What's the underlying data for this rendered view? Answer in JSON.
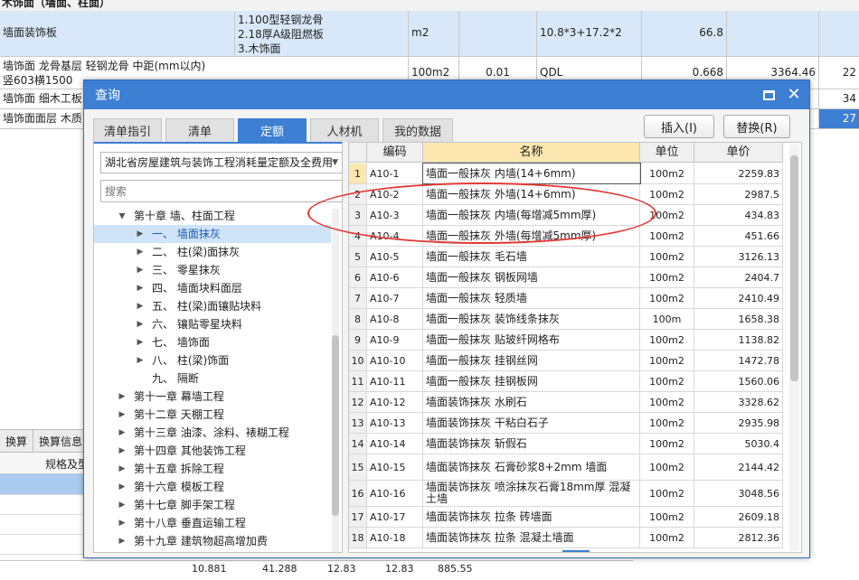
{
  "background": {
    "title": "木饰面（墙面、柱面）",
    "rows": [
      {
        "c1": "墙面装饰板",
        "c2": "1.100型轻钢龙骨\n2.18厚A级阻燃板\n3.木饰面",
        "c3": "m2",
        "c4": "",
        "c5": "10.8*3+17.2*2",
        "c6": "66.8",
        "c7": "",
        "c8": ""
      },
      {
        "c1": "墙饰面 龙骨基层 轻钢龙骨 中距(mm以内)\n竖603横1500",
        "c2": "",
        "c3": "100m2",
        "c4": "0.01",
        "c5": "QDL",
        "c6": "0.668",
        "c7": "3364.46",
        "c8": "22"
      },
      {
        "c1": "墙饰面 细木工板",
        "c2": "",
        "c3": "",
        "c4": "",
        "c5": "",
        "c6": "",
        "c7": "",
        "c8": "34"
      },
      {
        "c1": "墙饰面面层 木质",
        "c2": "",
        "c3": "",
        "c4": "",
        "c5": "",
        "c6": "",
        "c7": "",
        "c8": "27"
      }
    ],
    "lower_tabs": [
      "换算",
      "换算信息"
    ],
    "lower_header": "规格及型",
    "bottom_values": [
      "10.881",
      "41.288",
      "12.83",
      "12.83",
      "885.55"
    ]
  },
  "dialog": {
    "title": "查询",
    "tabs": [
      "清单指引",
      "清单",
      "定额",
      "人材机",
      "我的数据"
    ],
    "active_tab": "定额",
    "insert_label": "插入(I)",
    "replace_label": "替换(R)",
    "combo_value": "湖北省房屋建筑与装饰工程消耗量定额及全费用",
    "search_placeholder": "搜索",
    "tree": [
      {
        "label": "第十章 墙、柱面工程",
        "level": 0,
        "toggle": "▲",
        "selected": false
      },
      {
        "label": "一、 墙面抹灰",
        "level": 1,
        "toggle": "▶",
        "selected": true
      },
      {
        "label": "二、 柱(梁)面抹灰",
        "level": 1,
        "toggle": "▶",
        "selected": false
      },
      {
        "label": "三、 零星抹灰",
        "level": 1,
        "toggle": "▶",
        "selected": false
      },
      {
        "label": "四、 墙面块料面层",
        "level": 1,
        "toggle": "▶",
        "selected": false
      },
      {
        "label": "五、 柱(梁)面镶贴块料",
        "level": 1,
        "toggle": "▶",
        "selected": false
      },
      {
        "label": "六、 镶贴零星块料",
        "level": 1,
        "toggle": "▶",
        "selected": false
      },
      {
        "label": "七、 墙饰面",
        "level": 1,
        "toggle": "▶",
        "selected": false
      },
      {
        "label": "八、 柱(梁)饰面",
        "level": 1,
        "toggle": "▶",
        "selected": false
      },
      {
        "label": "九、 隔断",
        "level": 1,
        "toggle": "",
        "selected": false
      },
      {
        "label": "第十一章 幕墙工程",
        "level": 0,
        "toggle": "▶",
        "selected": false
      },
      {
        "label": "第十二章 天棚工程",
        "level": 0,
        "toggle": "▶",
        "selected": false
      },
      {
        "label": "第十三章 油漆、涂料、裱糊工程",
        "level": 0,
        "toggle": "▶",
        "selected": false
      },
      {
        "label": "第十四章 其他装饰工程",
        "level": 0,
        "toggle": "▶",
        "selected": false
      },
      {
        "label": "第十五章 拆除工程",
        "level": 0,
        "toggle": "▶",
        "selected": false
      },
      {
        "label": "第十六章 模板工程",
        "level": 0,
        "toggle": "▶",
        "selected": false
      },
      {
        "label": "第十七章 脚手架工程",
        "level": 0,
        "toggle": "▶",
        "selected": false
      },
      {
        "label": "第十八章 垂直运输工程",
        "level": 0,
        "toggle": "▶",
        "selected": false
      },
      {
        "label": "第十九章 建筑物超高增加费",
        "level": 0,
        "toggle": "▶",
        "selected": false
      }
    ],
    "grid_headers": {
      "idx": "",
      "code": "编码",
      "name": "名称",
      "unit": "单位",
      "price": "单价"
    },
    "grid_rows": [
      {
        "idx": "1",
        "code": "A10-1",
        "name": "墙面一般抹灰 内墙(14+6mm)",
        "unit": "100m2",
        "price": "2259.83"
      },
      {
        "idx": "2",
        "code": "A10-2",
        "name": "墙面一般抹灰 外墙(14+6mm)",
        "unit": "100m2",
        "price": "2987.5"
      },
      {
        "idx": "3",
        "code": "A10-3",
        "name": "墙面一般抹灰 内墙(每增减5mm厚)",
        "unit": "100m2",
        "price": "434.83"
      },
      {
        "idx": "4",
        "code": "A10-4",
        "name": "墙面一般抹灰 外墙(每增减5mm厚)",
        "unit": "100m2",
        "price": "451.66"
      },
      {
        "idx": "5",
        "code": "A10-5",
        "name": "墙面一般抹灰 毛石墙",
        "unit": "100m2",
        "price": "3126.13"
      },
      {
        "idx": "6",
        "code": "A10-6",
        "name": "墙面一般抹灰 钢板网墙",
        "unit": "100m2",
        "price": "2404.7"
      },
      {
        "idx": "7",
        "code": "A10-7",
        "name": "墙面一般抹灰 轻质墙",
        "unit": "100m2",
        "price": "2410.49"
      },
      {
        "idx": "8",
        "code": "A10-8",
        "name": "墙面一般抹灰 装饰线条抹灰",
        "unit": "100m",
        "price": "1658.38"
      },
      {
        "idx": "9",
        "code": "A10-9",
        "name": "墙面一般抹灰 贴玻纤网格布",
        "unit": "100m2",
        "price": "1138.82"
      },
      {
        "idx": "10",
        "code": "A10-10",
        "name": "墙面一般抹灰 挂钢丝网",
        "unit": "100m2",
        "price": "1472.78"
      },
      {
        "idx": "11",
        "code": "A10-11",
        "name": "墙面一般抹灰 挂钢板网",
        "unit": "100m2",
        "price": "1560.06"
      },
      {
        "idx": "12",
        "code": "A10-12",
        "name": "墙面装饰抹灰 水刷石",
        "unit": "100m2",
        "price": "3328.62"
      },
      {
        "idx": "13",
        "code": "A10-13",
        "name": "墙面装饰抹灰 干粘白石子",
        "unit": "100m2",
        "price": "2935.98"
      },
      {
        "idx": "14",
        "code": "A10-14",
        "name": "墙面装饰抹灰 斩假石",
        "unit": "100m2",
        "price": "5030.4"
      },
      {
        "idx": "15",
        "code": "A10-15",
        "name": "墙面装饰抹灰 石膏砂浆8+2mm 墙面",
        "unit": "100m2",
        "price": "2144.42"
      },
      {
        "idx": "16",
        "code": "A10-16",
        "name": "墙面装饰抹灰 喷涂抹灰石膏18mm厚 混凝土墙",
        "unit": "100m2",
        "price": "3048.56"
      },
      {
        "idx": "17",
        "code": "A10-17",
        "name": "墙面装饰抹灰 拉条 砖墙面",
        "unit": "100m2",
        "price": "2609.18"
      },
      {
        "idx": "18",
        "code": "A10-18",
        "name": "墙面装饰抹灰 拉条 混凝土墙面",
        "unit": "100m2",
        "price": "2812.36"
      }
    ],
    "colors": {
      "accent": "#3d7fd3",
      "highlight_header": "#fde7b0",
      "annotation": "#e53935"
    }
  }
}
